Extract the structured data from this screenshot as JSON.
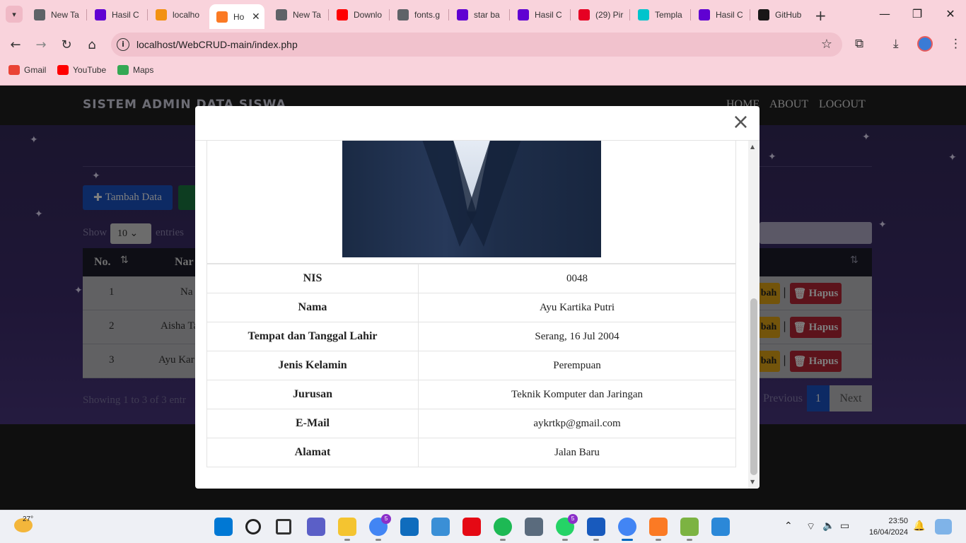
{
  "browser": {
    "tabs": [
      {
        "label": "New Ta",
        "icon": "globe-icon",
        "color": "#5f6368"
      },
      {
        "label": "Hasil C",
        "icon": "yahoo-icon",
        "color": "#6001d2"
      },
      {
        "label": "localho",
        "icon": "phpmyadmin-icon",
        "color": "#f29111"
      },
      {
        "label": "Ho",
        "icon": "xampp-icon",
        "color": "#fb7a24",
        "active": true
      },
      {
        "label": "New Ta",
        "icon": "globe-icon",
        "color": "#5f6368"
      },
      {
        "label": "Downlo",
        "icon": "youtube-icon",
        "color": "#ff0000"
      },
      {
        "label": "fonts.g",
        "icon": "globe-icon",
        "color": "#5f6368"
      },
      {
        "label": "star ba",
        "icon": "yahoo-icon",
        "color": "#6001d2"
      },
      {
        "label": "Hasil C",
        "icon": "yahoo-icon",
        "color": "#6001d2"
      },
      {
        "label": "(29) Pir",
        "icon": "pinterest-icon",
        "color": "#e60023"
      },
      {
        "label": "Templa",
        "icon": "canva-icon",
        "color": "#00c4cc"
      },
      {
        "label": "Hasil C",
        "icon": "yahoo-icon",
        "color": "#6001d2"
      },
      {
        "label": "GitHub",
        "icon": "github-icon",
        "color": "#181717"
      }
    ],
    "url": "localhost/WebCRUD-main/index.php",
    "bookmarks": [
      {
        "label": "Gmail",
        "icon": "gmail-icon",
        "color": "#ea4335"
      },
      {
        "label": "YouTube",
        "icon": "youtube-icon",
        "color": "#ff0000"
      },
      {
        "label": "Maps",
        "icon": "maps-icon",
        "color": "#34a853"
      }
    ]
  },
  "site": {
    "brand": "SISTEM ADMIN DATA SISWA",
    "nav": [
      "HOME",
      "ABOUT",
      "LOGOUT"
    ],
    "add_button": "Tambah Data",
    "show_label": "Show",
    "show_value": "10",
    "entries_label": "entries",
    "table_headers": [
      "No.",
      "Nar"
    ],
    "rows": [
      {
        "no": "1",
        "name": "Na"
      },
      {
        "no": "2",
        "name": "Aisha Ta"
      },
      {
        "no": "3",
        "name": "Ayu Kar"
      }
    ],
    "edit_label": "bah",
    "delete_label": "Hapus",
    "showing_text": "Showing 1 to 3 of 3 entr",
    "pagination": {
      "previous": "Previous",
      "current": "1",
      "next": "Next"
    }
  },
  "modal": {
    "close_label": "×",
    "details": [
      {
        "key": "NIS",
        "value": "0048"
      },
      {
        "key": "Nama",
        "value": "Ayu Kartika Putri"
      },
      {
        "key": "Tempat dan Tanggal Lahir",
        "value": "Serang, 16 Jul 2004"
      },
      {
        "key": "Jenis Kelamin",
        "value": "Perempuan"
      },
      {
        "key": "Jurusan",
        "value": "Teknik Komputer dan Jaringan"
      },
      {
        "key": "E-Mail",
        "value": "aykrtkp@gmail.com"
      },
      {
        "key": "Alamat",
        "value": "Jalan Baru"
      }
    ]
  },
  "taskbar": {
    "weather_temp": "27°",
    "time": "23:50",
    "date": "16/04/2024",
    "apps": [
      {
        "name": "start-icon",
        "color": "#0078d4"
      },
      {
        "name": "search-icon",
        "color": "#222222"
      },
      {
        "name": "task-view-icon",
        "color": "#333333"
      },
      {
        "name": "teams-meet-icon",
        "color": "#5b5fc7"
      },
      {
        "name": "file-explorer-icon",
        "color": "#f4c430"
      },
      {
        "name": "chrome-icon",
        "color": "#4285f4",
        "badge": "5"
      },
      {
        "name": "store-icon",
        "color": "#0f6cbd"
      },
      {
        "name": "monitor-app-icon",
        "color": "#3a8fd6"
      },
      {
        "name": "netflix-icon",
        "color": "#e50914"
      },
      {
        "name": "spotify-icon",
        "color": "#1db954"
      },
      {
        "name": "settings-icon",
        "color": "#5a6b7d"
      },
      {
        "name": "whatsapp-icon",
        "color": "#25d366",
        "badge": "5"
      },
      {
        "name": "word-icon",
        "color": "#185abd"
      },
      {
        "name": "chrome-profile-icon",
        "color": "#4285f4"
      },
      {
        "name": "xampp-icon",
        "color": "#fb7a24"
      },
      {
        "name": "notepad-icon",
        "color": "#7cb342"
      },
      {
        "name": "photos-icon",
        "color": "#2b88d8"
      }
    ]
  }
}
